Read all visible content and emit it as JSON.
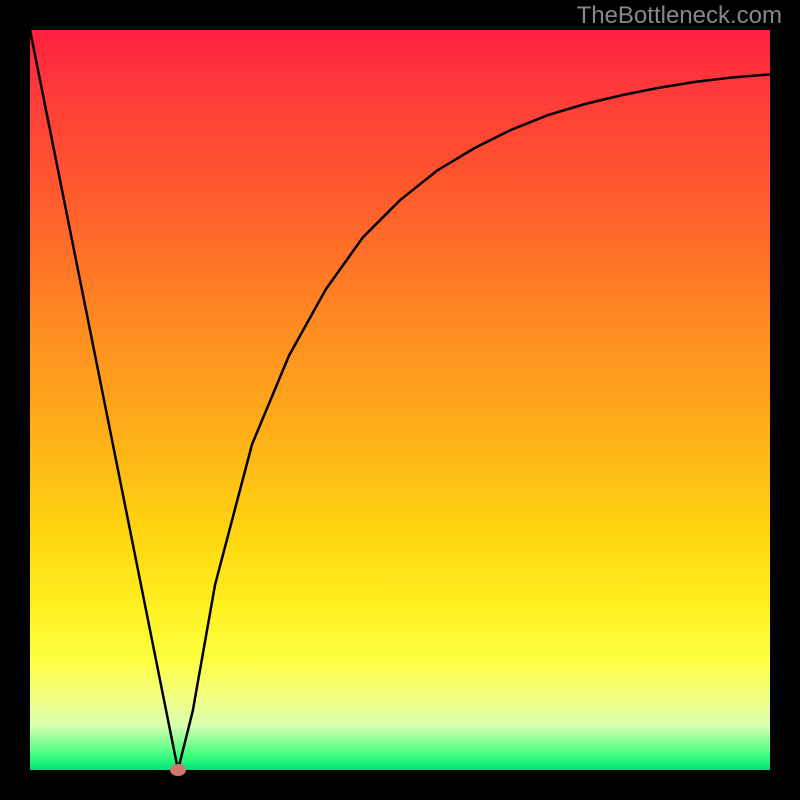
{
  "watermark": "TheBottleneck.com",
  "chart_data": {
    "type": "line",
    "title": "",
    "xlabel": "",
    "ylabel": "",
    "xlim": [
      0,
      100
    ],
    "ylim": [
      0,
      100
    ],
    "grid": false,
    "legend": false,
    "series": [
      {
        "name": "bottleneck-curve",
        "x": [
          0,
          5,
          10,
          15,
          18,
          20,
          22,
          25,
          30,
          35,
          40,
          45,
          50,
          55,
          60,
          65,
          70,
          75,
          80,
          85,
          90,
          95,
          100
        ],
        "values": [
          100,
          75,
          50,
          25,
          10,
          0,
          8,
          25,
          44,
          56,
          65,
          72,
          77,
          81,
          84,
          86.5,
          88.5,
          90,
          91.2,
          92.2,
          93,
          93.6,
          94
        ]
      }
    ],
    "marker": {
      "x": 20,
      "y": 0,
      "color": "#d1766e"
    },
    "background_gradient": {
      "top": "#ff2040",
      "bottom": "#00e078"
    }
  }
}
